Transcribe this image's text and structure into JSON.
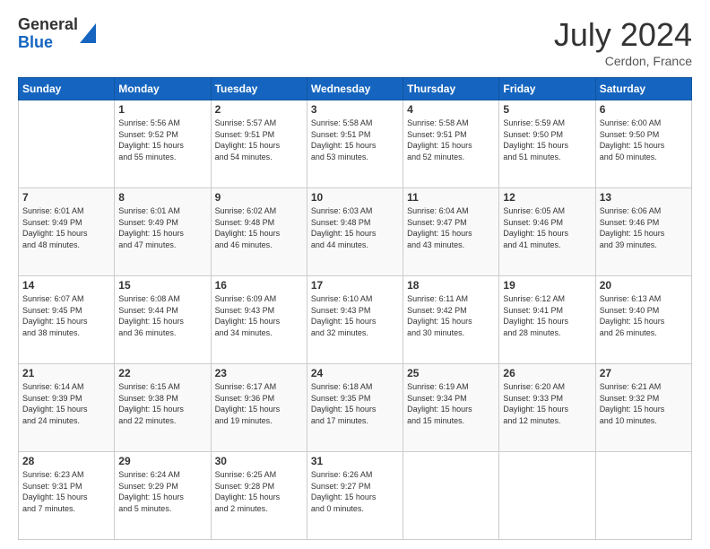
{
  "logo": {
    "general": "General",
    "blue": "Blue"
  },
  "header": {
    "month": "July 2024",
    "location": "Cerdon, France"
  },
  "weekdays": [
    "Sunday",
    "Monday",
    "Tuesday",
    "Wednesday",
    "Thursday",
    "Friday",
    "Saturday"
  ],
  "weeks": [
    [
      {
        "day": "",
        "text": ""
      },
      {
        "day": "1",
        "text": "Sunrise: 5:56 AM\nSunset: 9:52 PM\nDaylight: 15 hours\nand 55 minutes."
      },
      {
        "day": "2",
        "text": "Sunrise: 5:57 AM\nSunset: 9:51 PM\nDaylight: 15 hours\nand 54 minutes."
      },
      {
        "day": "3",
        "text": "Sunrise: 5:58 AM\nSunset: 9:51 PM\nDaylight: 15 hours\nand 53 minutes."
      },
      {
        "day": "4",
        "text": "Sunrise: 5:58 AM\nSunset: 9:51 PM\nDaylight: 15 hours\nand 52 minutes."
      },
      {
        "day": "5",
        "text": "Sunrise: 5:59 AM\nSunset: 9:50 PM\nDaylight: 15 hours\nand 51 minutes."
      },
      {
        "day": "6",
        "text": "Sunrise: 6:00 AM\nSunset: 9:50 PM\nDaylight: 15 hours\nand 50 minutes."
      }
    ],
    [
      {
        "day": "7",
        "text": "Sunrise: 6:01 AM\nSunset: 9:49 PM\nDaylight: 15 hours\nand 48 minutes."
      },
      {
        "day": "8",
        "text": "Sunrise: 6:01 AM\nSunset: 9:49 PM\nDaylight: 15 hours\nand 47 minutes."
      },
      {
        "day": "9",
        "text": "Sunrise: 6:02 AM\nSunset: 9:48 PM\nDaylight: 15 hours\nand 46 minutes."
      },
      {
        "day": "10",
        "text": "Sunrise: 6:03 AM\nSunset: 9:48 PM\nDaylight: 15 hours\nand 44 minutes."
      },
      {
        "day": "11",
        "text": "Sunrise: 6:04 AM\nSunset: 9:47 PM\nDaylight: 15 hours\nand 43 minutes."
      },
      {
        "day": "12",
        "text": "Sunrise: 6:05 AM\nSunset: 9:46 PM\nDaylight: 15 hours\nand 41 minutes."
      },
      {
        "day": "13",
        "text": "Sunrise: 6:06 AM\nSunset: 9:46 PM\nDaylight: 15 hours\nand 39 minutes."
      }
    ],
    [
      {
        "day": "14",
        "text": "Sunrise: 6:07 AM\nSunset: 9:45 PM\nDaylight: 15 hours\nand 38 minutes."
      },
      {
        "day": "15",
        "text": "Sunrise: 6:08 AM\nSunset: 9:44 PM\nDaylight: 15 hours\nand 36 minutes."
      },
      {
        "day": "16",
        "text": "Sunrise: 6:09 AM\nSunset: 9:43 PM\nDaylight: 15 hours\nand 34 minutes."
      },
      {
        "day": "17",
        "text": "Sunrise: 6:10 AM\nSunset: 9:43 PM\nDaylight: 15 hours\nand 32 minutes."
      },
      {
        "day": "18",
        "text": "Sunrise: 6:11 AM\nSunset: 9:42 PM\nDaylight: 15 hours\nand 30 minutes."
      },
      {
        "day": "19",
        "text": "Sunrise: 6:12 AM\nSunset: 9:41 PM\nDaylight: 15 hours\nand 28 minutes."
      },
      {
        "day": "20",
        "text": "Sunrise: 6:13 AM\nSunset: 9:40 PM\nDaylight: 15 hours\nand 26 minutes."
      }
    ],
    [
      {
        "day": "21",
        "text": "Sunrise: 6:14 AM\nSunset: 9:39 PM\nDaylight: 15 hours\nand 24 minutes."
      },
      {
        "day": "22",
        "text": "Sunrise: 6:15 AM\nSunset: 9:38 PM\nDaylight: 15 hours\nand 22 minutes."
      },
      {
        "day": "23",
        "text": "Sunrise: 6:17 AM\nSunset: 9:36 PM\nDaylight: 15 hours\nand 19 minutes."
      },
      {
        "day": "24",
        "text": "Sunrise: 6:18 AM\nSunset: 9:35 PM\nDaylight: 15 hours\nand 17 minutes."
      },
      {
        "day": "25",
        "text": "Sunrise: 6:19 AM\nSunset: 9:34 PM\nDaylight: 15 hours\nand 15 minutes."
      },
      {
        "day": "26",
        "text": "Sunrise: 6:20 AM\nSunset: 9:33 PM\nDaylight: 15 hours\nand 12 minutes."
      },
      {
        "day": "27",
        "text": "Sunrise: 6:21 AM\nSunset: 9:32 PM\nDaylight: 15 hours\nand 10 minutes."
      }
    ],
    [
      {
        "day": "28",
        "text": "Sunrise: 6:23 AM\nSunset: 9:31 PM\nDaylight: 15 hours\nand 7 minutes."
      },
      {
        "day": "29",
        "text": "Sunrise: 6:24 AM\nSunset: 9:29 PM\nDaylight: 15 hours\nand 5 minutes."
      },
      {
        "day": "30",
        "text": "Sunrise: 6:25 AM\nSunset: 9:28 PM\nDaylight: 15 hours\nand 2 minutes."
      },
      {
        "day": "31",
        "text": "Sunrise: 6:26 AM\nSunset: 9:27 PM\nDaylight: 15 hours\nand 0 minutes."
      },
      {
        "day": "",
        "text": ""
      },
      {
        "day": "",
        "text": ""
      },
      {
        "day": "",
        "text": ""
      }
    ]
  ]
}
